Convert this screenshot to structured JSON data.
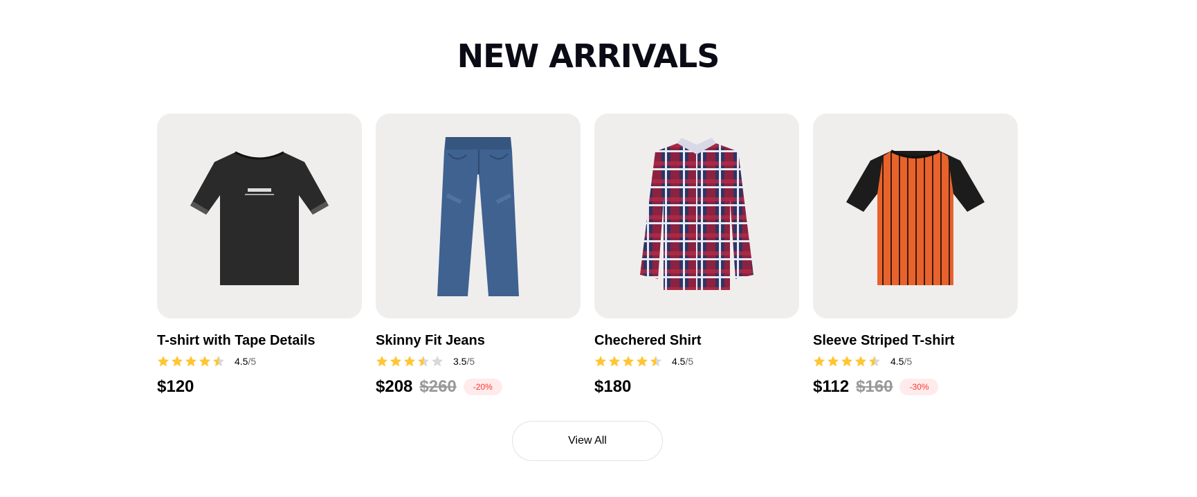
{
  "section": {
    "title": "NEW ARRIVALS"
  },
  "products": [
    {
      "name": "T-shirt with Tape Details",
      "rating": "4.5",
      "rating_max": "/5",
      "stars": [
        1,
        1,
        1,
        1,
        0.5
      ],
      "price": "$120",
      "old_price": "",
      "discount": "",
      "image_icon": "black-tshirt-icon"
    },
    {
      "name": "Skinny Fit Jeans",
      "rating": "3.5",
      "rating_max": "/5",
      "stars": [
        1,
        1,
        1,
        0.5,
        0
      ],
      "price": "$208",
      "old_price": "$260",
      "discount": "-20%",
      "image_icon": "jeans-icon"
    },
    {
      "name": "Chechered Shirt",
      "rating": "4.5",
      "rating_max": "/5",
      "stars": [
        1,
        1,
        1,
        1,
        0.5
      ],
      "price": "$180",
      "old_price": "",
      "discount": "",
      "image_icon": "plaid-shirt-icon"
    },
    {
      "name": "Sleeve Striped T-shirt",
      "rating": "4.5",
      "rating_max": "/5",
      "stars": [
        1,
        1,
        1,
        1,
        0.5
      ],
      "price": "$112",
      "old_price": "$160",
      "discount": "-30%",
      "image_icon": "striped-tshirt-icon"
    }
  ],
  "view_all": {
    "label": "View All"
  },
  "colors": {
    "star": "#ffc633",
    "star_empty": "#d8d8d8",
    "card_bg": "#f0eeed",
    "discount_bg": "#ffebeb",
    "discount_text": "#ff3333"
  }
}
